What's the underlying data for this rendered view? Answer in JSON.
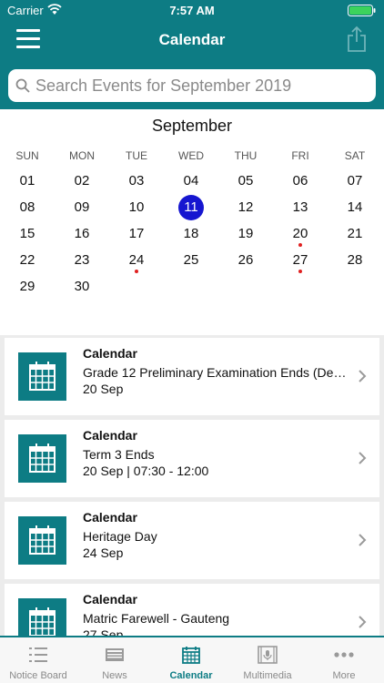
{
  "status": {
    "carrier": "Carrier",
    "time": "7:57 AM"
  },
  "nav": {
    "title": "Calendar"
  },
  "search": {
    "placeholder": "Search Events for September 2019"
  },
  "calendar": {
    "month": "September",
    "weekdays": [
      "SUN",
      "MON",
      "TUE",
      "WED",
      "THU",
      "FRI",
      "SAT"
    ],
    "weeks": [
      [
        "01",
        "02",
        "03",
        "04",
        "05",
        "06",
        "07"
      ],
      [
        "08",
        "09",
        "10",
        "11",
        "12",
        "13",
        "14"
      ],
      [
        "15",
        "16",
        "17",
        "18",
        "19",
        "20",
        "21"
      ],
      [
        "22",
        "23",
        "24",
        "25",
        "26",
        "27",
        "28"
      ],
      [
        "29",
        "30",
        "",
        "",
        "",
        "",
        ""
      ]
    ],
    "selected_day": "11",
    "event_days": [
      "20",
      "24",
      "27"
    ]
  },
  "events": [
    {
      "category": "Calendar",
      "title": "Grade 12 Preliminary Examination Ends (Det...",
      "detail": "20 Sep"
    },
    {
      "category": "Calendar",
      "title": "Term 3 Ends",
      "detail": "20 Sep | 07:30 - 12:00"
    },
    {
      "category": "Calendar",
      "title": "Heritage Day",
      "detail": "24 Sep"
    },
    {
      "category": "Calendar",
      "title": "Matric Farewell - Gauteng",
      "detail": "27 Sep"
    }
  ],
  "tabs": [
    {
      "label": "Notice Board",
      "icon": "list-icon"
    },
    {
      "label": "News",
      "icon": "news-icon"
    },
    {
      "label": "Calendar",
      "icon": "calendar-icon",
      "active": true
    },
    {
      "label": "Multimedia",
      "icon": "multimedia-icon"
    },
    {
      "label": "More",
      "icon": "more-icon"
    }
  ],
  "colors": {
    "brand": "#0d7c84",
    "selected_day": "#1616d0",
    "event_dot": "#e02020"
  }
}
